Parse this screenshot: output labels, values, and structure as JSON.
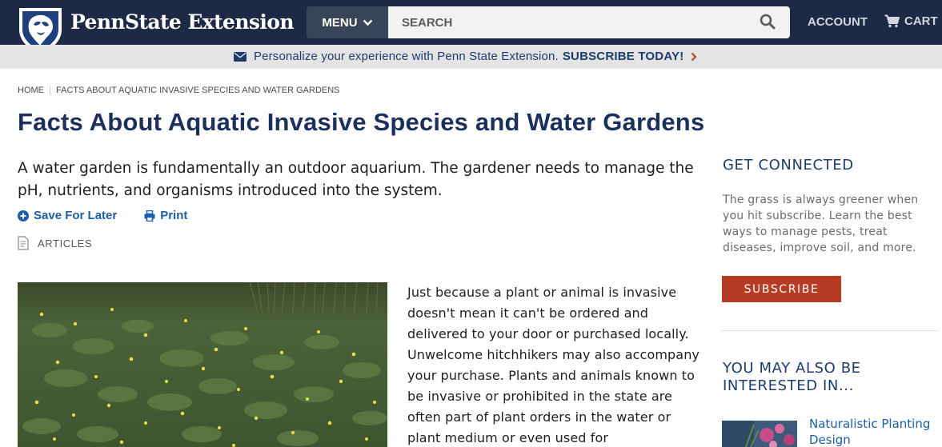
{
  "header": {
    "brand": "PennState Extension",
    "menu_label": "MENU",
    "search_placeholder": "SEARCH",
    "account_label": "ACCOUNT",
    "cart_label": "CART"
  },
  "banner": {
    "text": "Personalize your experience with Penn State Extension.",
    "cta": "SUBSCRIBE TODAY!"
  },
  "breadcrumb": {
    "home": "HOME",
    "current": "FACTS ABOUT AQUATIC INVASIVE SPECIES AND WATER GARDENS"
  },
  "page": {
    "title": "Facts About Aquatic Invasive Species and Water Gardens",
    "lede": "A water garden is fundamentally an outdoor aquarium. The gardener needs to manage the pH, nutrients, and organisms introduced into the system.",
    "save_label": "Save For Later",
    "print_label": "Print",
    "content_type": "ARTICLES",
    "body": "Just because a plant or animal is invasive doesn't mean it can't be ordered and delivered to your door or purchased locally. Unwelcome hitchhikers may also accompany your purchase. Plants and animals known to be invasive or prohibited in the state are often part of plant orders in the water or plant medium or even used for"
  },
  "sidebar": {
    "connect_heading": "GET CONNECTED",
    "connect_text": "The grass is always greener when you hit subscribe. Learn the best ways to manage pests, treat diseases, improve soil, and more.",
    "subscribe_label": "SUBSCRIBE",
    "related_heading": "YOU MAY ALSO BE INTERESTED IN...",
    "related": [
      {
        "title": "Naturalistic Planting Design"
      }
    ]
  },
  "colors": {
    "nav_bg": "#1e2a45",
    "title_blue": "#1d2f5c",
    "link_blue": "#1d5ea8",
    "subscribe_red": "#b83b26",
    "banner_bg": "#e4e4e4"
  }
}
